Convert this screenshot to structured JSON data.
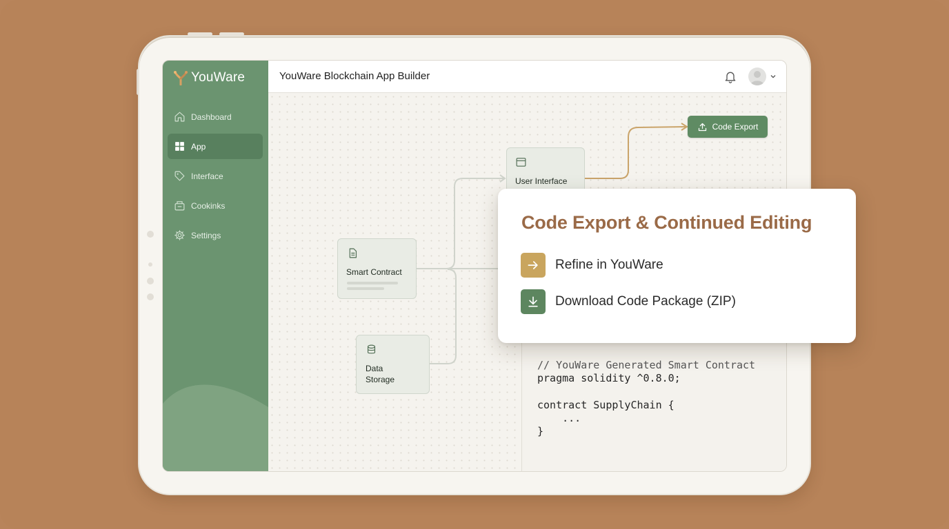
{
  "app": {
    "brand_name": "YouWare",
    "header_title": "YouWare Blockchain App Builder"
  },
  "sidebar": {
    "items": [
      {
        "label": "Dashboard",
        "icon": "home-icon",
        "active": false
      },
      {
        "label": "App",
        "icon": "grid-icon",
        "active": true
      },
      {
        "label": "Interface",
        "icon": "tag-icon",
        "active": false
      },
      {
        "label": "Cookinks",
        "icon": "box-icon",
        "active": false
      },
      {
        "label": "Settings",
        "icon": "gear-icon",
        "active": false
      }
    ]
  },
  "canvas": {
    "nodes": {
      "user_interface": "User Interface",
      "smart_contract": "Smart Contract",
      "data_storage_line1": "Data",
      "data_storage_line2": "Storage"
    },
    "export_button": "Code Export"
  },
  "code": {
    "lines": [
      "// YouWare Generated Smart Contract",
      "pragma solidity ^0.8.0;",
      "",
      "contract SupplyChain {",
      "    ...",
      "}"
    ]
  },
  "popup": {
    "title": "Code Export & Continued Editing",
    "options": [
      {
        "label": "Refine in YouWare",
        "icon": "arrow-right-icon",
        "color": "#c9a55e"
      },
      {
        "label": "Download Code Package (ZIP)",
        "icon": "download-icon",
        "color": "#5d865f"
      }
    ]
  },
  "colors": {
    "background": "#b78359",
    "sidebar": "#6b9470",
    "accent_green": "#5f8b63",
    "accent_gold": "#c9a55e",
    "title_brown": "#9a6a47"
  }
}
